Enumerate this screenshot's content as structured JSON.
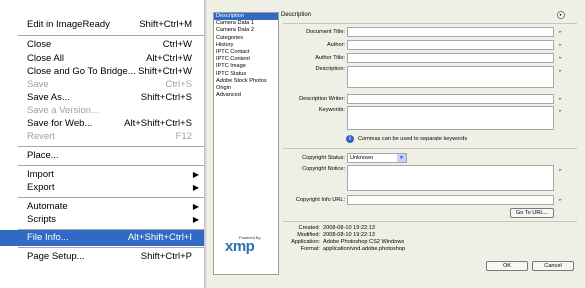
{
  "menu": {
    "items": [
      {
        "label": "Edit in ImageReady",
        "shortcut": "Shift+Ctrl+M",
        "state": "normal"
      },
      {
        "label": "Close",
        "shortcut": "Ctrl+W",
        "state": "normal"
      },
      {
        "label": "Close All",
        "shortcut": "Alt+Ctrl+W",
        "state": "normal"
      },
      {
        "label": "Close and Go To Bridge...",
        "shortcut": "Shift+Ctrl+W",
        "state": "normal"
      },
      {
        "label": "Save",
        "shortcut": "Ctrl+S",
        "state": "disabled"
      },
      {
        "label": "Save As...",
        "shortcut": "Shift+Ctrl+S",
        "state": "normal"
      },
      {
        "label": "Save a Version...",
        "shortcut": "",
        "state": "disabled"
      },
      {
        "label": "Save for Web...",
        "shortcut": "Alt+Shift+Ctrl+S",
        "state": "normal"
      },
      {
        "label": "Revert",
        "shortcut": "F12",
        "state": "disabled"
      },
      {
        "label": "Place...",
        "shortcut": "",
        "state": "normal"
      },
      {
        "label": "Import",
        "shortcut": "",
        "state": "submenu"
      },
      {
        "label": "Export",
        "shortcut": "",
        "state": "submenu"
      },
      {
        "label": "Automate",
        "shortcut": "",
        "state": "submenu"
      },
      {
        "label": "Scripts",
        "shortcut": "",
        "state": "submenu"
      },
      {
        "label": "File Info...",
        "shortcut": "Alt+Shift+Ctrl+I",
        "state": "selected"
      },
      {
        "label": "Page Setup...",
        "shortcut": "Shift+Ctrl+P",
        "state": "normal"
      }
    ],
    "submenu_arrow": "▶",
    "selected_color": "#316ac5"
  },
  "dialog": {
    "categories": [
      "Description",
      "Camera Data 1",
      "Camera Data 2",
      "Categories",
      "History",
      "IPTC Contact",
      "IPTC Content",
      "IPTC Image",
      "IPTC Status",
      "Adobe Stock Photos",
      "Origin",
      "Advanced"
    ],
    "selected_category": "Description",
    "section_title": "Description",
    "fields": {
      "document_title": {
        "label": "Document Title:",
        "value": ""
      },
      "author": {
        "label": "Author:",
        "value": ""
      },
      "author_title": {
        "label": "Author Title:",
        "value": ""
      },
      "description": {
        "label": "Description:",
        "value": ""
      },
      "description_writer": {
        "label": "Description Writer:",
        "value": ""
      },
      "keywords": {
        "label": "Keywords:",
        "value": ""
      },
      "copyright_status": {
        "label": "Copyright Status:",
        "value": "Unknown"
      },
      "copyright_notice": {
        "label": "Copyright Notice:",
        "value": ""
      },
      "copyright_info_url": {
        "label": "Copyright Info URL:",
        "value": ""
      }
    },
    "keywords_hint": "Commas can be used to separate keywords",
    "go_to_url_button": "Go To URL...",
    "metadata": [
      {
        "label": "Created:",
        "value": "2008-08-10 19:22:13"
      },
      {
        "label": "Modified:",
        "value": "2008-08-10 19:22:13"
      },
      {
        "label": "Application:",
        "value": "Adobe Photoshop CS2 Windows"
      },
      {
        "label": "Format:",
        "value": "application/vnd.adobe.photoshop"
      }
    ],
    "logo": {
      "powered_by": "Powered By",
      "name": "xmp"
    },
    "ok_button": "OK",
    "cancel_button": "Cancel",
    "options_icon": "flyout-menu-icon"
  }
}
